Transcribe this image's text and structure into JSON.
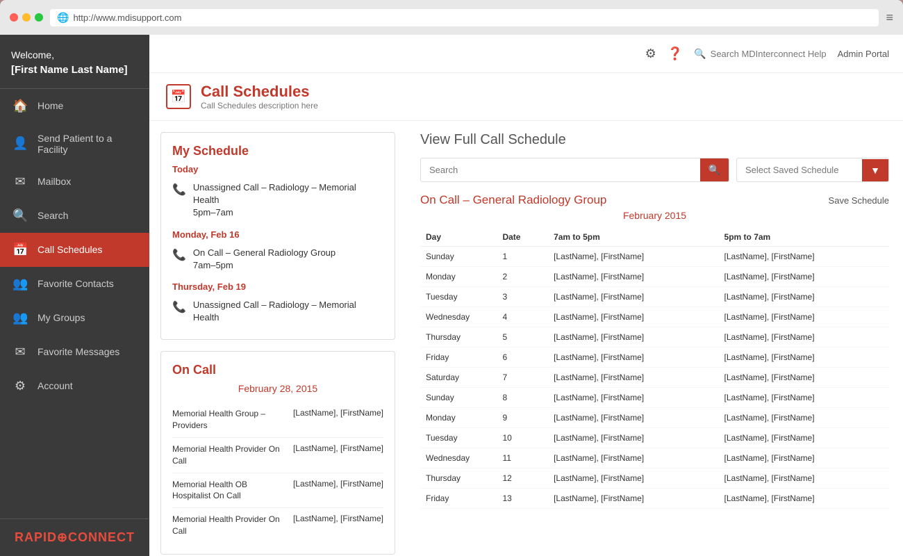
{
  "browser": {
    "url": "http://www.mdisupport.com",
    "dots": [
      "red",
      "yellow",
      "green"
    ]
  },
  "sidebar": {
    "welcome": "Welcome,",
    "user_name": "[First Name Last Name]",
    "nav_items": [
      {
        "id": "home",
        "label": "Home",
        "icon": "🏠",
        "active": false
      },
      {
        "id": "send-patient",
        "label": "Send Patient to a Facility",
        "icon": "👤",
        "active": false
      },
      {
        "id": "mailbox",
        "label": "Mailbox",
        "icon": "✉",
        "active": false
      },
      {
        "id": "search",
        "label": "Search",
        "icon": "🔍",
        "active": false
      },
      {
        "id": "call-schedules",
        "label": "Call Schedules",
        "icon": "📅",
        "active": true
      },
      {
        "id": "favorite-contacts",
        "label": "Favorite Contacts",
        "icon": "👥",
        "active": false
      },
      {
        "id": "my-groups",
        "label": "My Groups",
        "icon": "👥",
        "active": false
      },
      {
        "id": "favorite-messages",
        "label": "Favorite Messages",
        "icon": "✉",
        "active": false
      },
      {
        "id": "account",
        "label": "Account",
        "icon": "⚙",
        "active": false
      }
    ],
    "brand": "RAPID⊕CONNECT"
  },
  "topbar": {
    "search_placeholder": "Search MDInterconnect Help",
    "admin_portal": "Admin Portal"
  },
  "page_header": {
    "title": "Call Schedules",
    "description": "Call Schedules description here"
  },
  "my_schedule": {
    "title": "My Schedule",
    "entries": [
      {
        "date_label": "Today",
        "items": [
          {
            "text": "Unassigned Call – Radiology – Memorial Health\n5pm–7am"
          }
        ]
      },
      {
        "date_label": "Monday, Feb 16",
        "items": [
          {
            "text": "On Call – General Radiology Group\n7am–5pm"
          }
        ]
      },
      {
        "date_label": "Thursday, Feb 19",
        "items": [
          {
            "text": "Unassigned Call – Radiology – Memorial Health"
          }
        ]
      }
    ]
  },
  "on_call": {
    "title": "On Call",
    "date": "February 28, 2015",
    "items": [
      {
        "group": "Memorial Health Group – Providers",
        "name": "[LastName], [FirstName]"
      },
      {
        "group": "Memorial Health Provider On Call",
        "name": "[LastName], [FirstName]"
      },
      {
        "group": "Memorial Health OB Hospitalist On Call",
        "name": "[LastName], [FirstName]"
      },
      {
        "group": "Memorial Health Provider On Call",
        "name": "[LastName], [FirstName]"
      }
    ]
  },
  "view_full": {
    "title": "View Full Call Schedule",
    "search_placeholder": "Search",
    "select_schedule_placeholder": "Select Saved Schedule",
    "group_title": "On Call – General Radiology Group",
    "save_schedule": "Save Schedule",
    "month_label": "February 2015",
    "columns": [
      "Day",
      "Date",
      "7am to 5pm",
      "5pm to 7am"
    ],
    "rows": [
      {
        "day": "Sunday",
        "date": "1",
        "shift1": "[LastName], [FirstName]",
        "shift2": "[LastName], [FirstName]"
      },
      {
        "day": "Monday",
        "date": "2",
        "shift1": "[LastName], [FirstName]",
        "shift2": "[LastName], [FirstName]"
      },
      {
        "day": "Tuesday",
        "date": "3",
        "shift1": "[LastName], [FirstName]",
        "shift2": "[LastName], [FirstName]"
      },
      {
        "day": "Wednesday",
        "date": "4",
        "shift1": "[LastName], [FirstName]",
        "shift2": "[LastName], [FirstName]"
      },
      {
        "day": "Thursday",
        "date": "5",
        "shift1": "[LastName], [FirstName]",
        "shift2": "[LastName], [FirstName]"
      },
      {
        "day": "Friday",
        "date": "6",
        "shift1": "[LastName], [FirstName]",
        "shift2": "[LastName], [FirstName]"
      },
      {
        "day": "Saturday",
        "date": "7",
        "shift1": "[LastName], [FirstName]",
        "shift2": "[LastName], [FirstName]"
      },
      {
        "day": "Sunday",
        "date": "8",
        "shift1": "[LastName], [FirstName]",
        "shift2": "[LastName], [FirstName]"
      },
      {
        "day": "Monday",
        "date": "9",
        "shift1": "[LastName], [FirstName]",
        "shift2": "[LastName], [FirstName]"
      },
      {
        "day": "Tuesday",
        "date": "10",
        "shift1": "[LastName], [FirstName]",
        "shift2": "[LastName], [FirstName]"
      },
      {
        "day": "Wednesday",
        "date": "11",
        "shift1": "[LastName], [FirstName]",
        "shift2": "[LastName], [FirstName]"
      },
      {
        "day": "Thursday",
        "date": "12",
        "shift1": "[LastName], [FirstName]",
        "shift2": "[LastName], [FirstName]"
      },
      {
        "day": "Friday",
        "date": "13",
        "shift1": "[LastName], [FirstName]",
        "shift2": "[LastName], [FirstName]"
      }
    ]
  }
}
